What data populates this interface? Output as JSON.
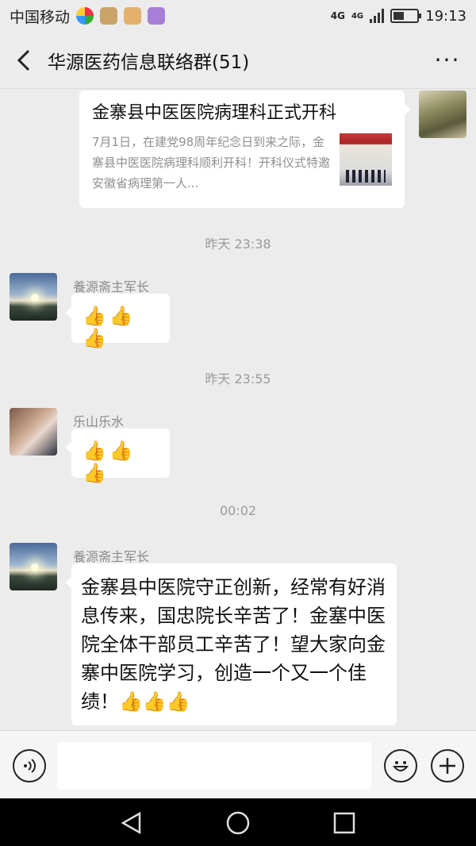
{
  "status": {
    "carrier": "中国移动",
    "net_top": "4G",
    "net_small": "4G",
    "time": "19:13",
    "battery_level": 0.45
  },
  "header": {
    "title": "华源医药信息联络群(51)",
    "more": "···"
  },
  "messages": {
    "card": {
      "title": "金寨县中医医院病理科正式开科",
      "desc": "7月1日，在建党98周年纪念日到来之际，金寨县中医医院病理科顺利开科！开科仪式特邀安徽省病理第一人..."
    },
    "time1": "昨天 23:38",
    "msg1": {
      "sender": "養源斋主军长",
      "text": "👍👍👍"
    },
    "time2": "昨天 23:55",
    "msg2": {
      "sender": "乐山乐水",
      "text": "👍👍👍"
    },
    "time3": "00:02",
    "msg3": {
      "sender": "養源斋主军长",
      "text": "金寨县中医院守正创新，经常有好消息传来，国忠院长辛苦了！金塞中医院全体干部员工辛苦了！望大家向金寨中医院学习，创造一个又一个佳绩！👍👍👍"
    }
  },
  "input": {
    "placeholder": ""
  }
}
